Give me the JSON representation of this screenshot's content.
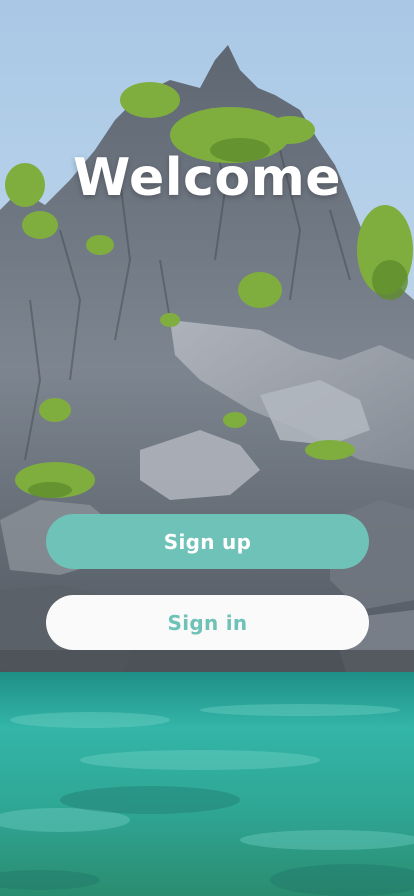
{
  "welcome": {
    "title": "Welcome",
    "signup_label": "Sign up",
    "signin_label": "Sign in"
  },
  "colors": {
    "accent": "#6fc2b7",
    "signin_background": "#fafafa",
    "title_text": "#ffffff"
  },
  "background": {
    "scene": "limestone-cliff-over-turquoise-lagoon"
  }
}
